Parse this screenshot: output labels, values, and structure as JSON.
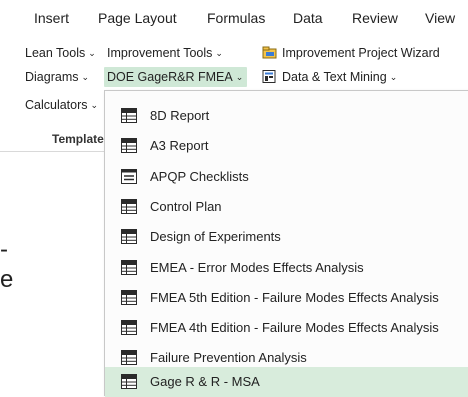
{
  "tabs": [
    "Insert",
    "Page Layout",
    "Formulas",
    "Data",
    "Review",
    "View"
  ],
  "ribbon": {
    "lean_tools": "Lean Tools",
    "improvement_tools": "Improvement Tools",
    "improvement_wizard": "Improvement Project Wizard",
    "diagrams": "Diagrams",
    "doe_gage_fmea": "DOE GageR&R FMEA",
    "data_text_mining": "Data & Text Mining",
    "calculators": "Calculators",
    "group_label": "Templates"
  },
  "menu": {
    "items": [
      {
        "label": "8D Report",
        "icon": "table-icon"
      },
      {
        "label": "A3 Report",
        "icon": "table-icon"
      },
      {
        "label": "APQP Checklists",
        "icon": "checklist-icon"
      },
      {
        "label": "Control Plan",
        "icon": "table-icon"
      },
      {
        "label": "Design of Experiments",
        "icon": "table-icon"
      },
      {
        "label": "EMEA - Error Modes Effects Analysis",
        "icon": "table-icon"
      },
      {
        "label": "FMEA 5th Edition - Failure Modes Effects Analysis",
        "icon": "table-icon"
      },
      {
        "label": "FMEA 4th Edition - Failure Modes Effects Analysis",
        "icon": "table-icon"
      },
      {
        "label": "Failure Prevention Analysis",
        "icon": "table-icon"
      },
      {
        "label": "Gage R & R - MSA",
        "icon": "table-icon"
      }
    ]
  },
  "colors": {
    "highlight": "#cfe8d6",
    "hover": "#d8ecdc",
    "icon_dark": "#2b2b2b"
  }
}
